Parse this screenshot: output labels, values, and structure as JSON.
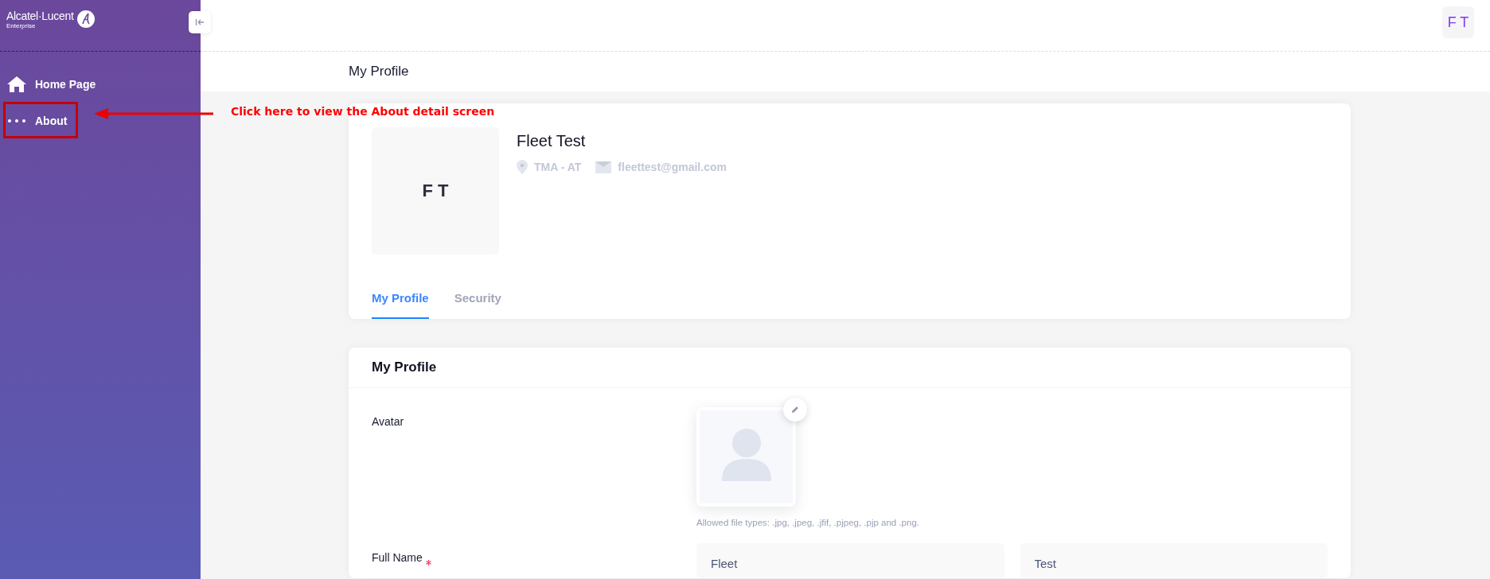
{
  "sidebar": {
    "logo": {
      "brand": "Alcatel·Lucent",
      "sub": "Enterprise"
    },
    "items": [
      {
        "label": "Home Page",
        "selected": false
      },
      {
        "label": "About",
        "selected": false
      }
    ]
  },
  "annotation": {
    "text": "Click here to view the About detail screen"
  },
  "header": {
    "user_initials": "F T"
  },
  "breadcrumb": "My Profile",
  "profile": {
    "initials": "F T",
    "name": "Fleet Test",
    "location": "TMA - AT",
    "email": "fleettest@gmail.com",
    "tabs": [
      {
        "label": "My Profile",
        "selected": true
      },
      {
        "label": "Security",
        "selected": false
      }
    ]
  },
  "form": {
    "title": "My Profile",
    "avatar_label": "Avatar",
    "avatar_hint": "Allowed file types: .jpg, .jpeg, .jfif, .pjpeg, .pjp and .png.",
    "full_name": {
      "label": "Full Name",
      "required": true,
      "first": "Fleet",
      "last": "Test"
    }
  }
}
